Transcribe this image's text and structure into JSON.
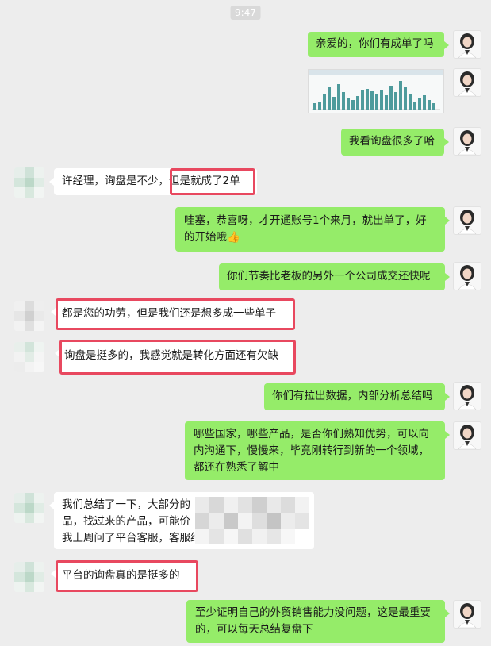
{
  "status": {
    "time": "9:47"
  },
  "conversation": {
    "messages": [
      {
        "side": "out",
        "text": "亲爱的，你们有成单了吗"
      },
      {
        "side": "out",
        "type": "image"
      },
      {
        "side": "out",
        "text": "我看询盘很多了哈"
      },
      {
        "side": "in",
        "text_a": "许经理，询盘是不少，",
        "text_b": "但是就成了2单",
        "highlighted": true
      },
      {
        "side": "out",
        "line1": "哇塞，恭喜呀，才开通账号1个来月，就出单了，好",
        "line2": "的开始哦",
        "emoji": "👍"
      },
      {
        "side": "out",
        "text": "你们节奏比老板的另外一个公司成交还快呢"
      },
      {
        "side": "in",
        "text": "都是您的功劳，但是我们还是想多成一些单子",
        "highlighted": true
      },
      {
        "side": "in",
        "text": "询盘是挺多的，我感觉就是转化方面还有欠缺",
        "highlighted": true
      },
      {
        "side": "out",
        "text": "你们有拉出数据，内部分析总结吗"
      },
      {
        "side": "out",
        "line1": "哪些国家，哪些产品，是否你们熟知优势，可以向",
        "line2": "内沟通下，慢慢来，毕竟刚转行到新的一个领域，",
        "line3": "都还在熟悉了解中"
      },
      {
        "side": "in",
        "line1": "我们总结了一下，大部分的",
        "line2": "品，找过来的产品，可能价",
        "line3": "我上周问了平台客服，客服给了"
      },
      {
        "side": "in",
        "text": "平台的询盘真的是挺多的",
        "highlighted": true
      },
      {
        "side": "out",
        "line1": "至少证明自己的外贸销售能力没问题，这是最重要",
        "line2": "的，可以每天总结复盘下"
      }
    ]
  },
  "colors": {
    "background": "#ededed",
    "outgoing_bubble": "#95ec69",
    "incoming_bubble": "#ffffff",
    "highlight_border": "#e8485f"
  },
  "icons": {
    "avatar_me": "avatar-woman-icon",
    "avatar_other": "avatar-blurred-icon",
    "thumbs_up": "thumbs-up-icon"
  }
}
